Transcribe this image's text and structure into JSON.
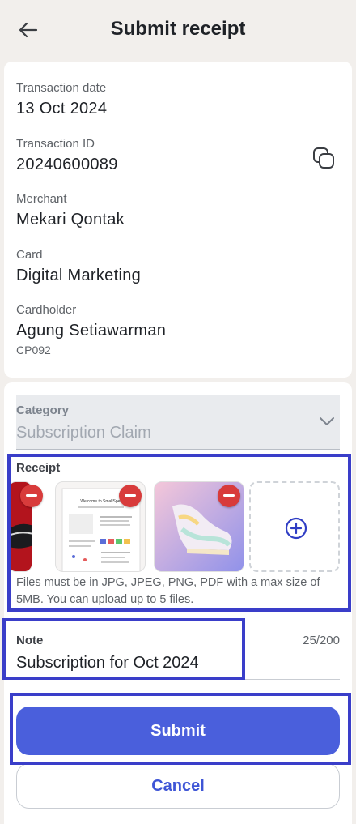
{
  "header": {
    "title": "Submit receipt",
    "back_icon": "arrow-left-icon"
  },
  "transaction": {
    "date_label": "Transaction date",
    "date_value": "13 Oct 2024",
    "id_label": "Transaction ID",
    "id_value": "20240600089",
    "copy_icon": "copy-icon",
    "merchant_label": "Merchant",
    "merchant_value": "Mekari Qontak",
    "card_label": "Card",
    "card_value": "Digital Marketing",
    "cardholder_label": "Cardholder",
    "cardholder_value": "Agung Setiawarman",
    "cardholder_code": "CP092"
  },
  "category": {
    "label": "Category",
    "value": "Subscription Claim"
  },
  "receipt": {
    "label": "Receipt",
    "helper": "Files must be in JPG, JPEG, PNG, PDF with a max size of 5MB. You can upload up to 5 files.",
    "doc_title": "Welcome to SmallSpell"
  },
  "note": {
    "label": "Note",
    "counter": "25/200",
    "value": "Subscription for Oct 2024"
  },
  "actions": {
    "submit": "Submit",
    "cancel": "Cancel"
  },
  "colors": {
    "primary": "#4a5fdc",
    "danger": "#d83b3b",
    "highlight": "#3a3ec9"
  }
}
